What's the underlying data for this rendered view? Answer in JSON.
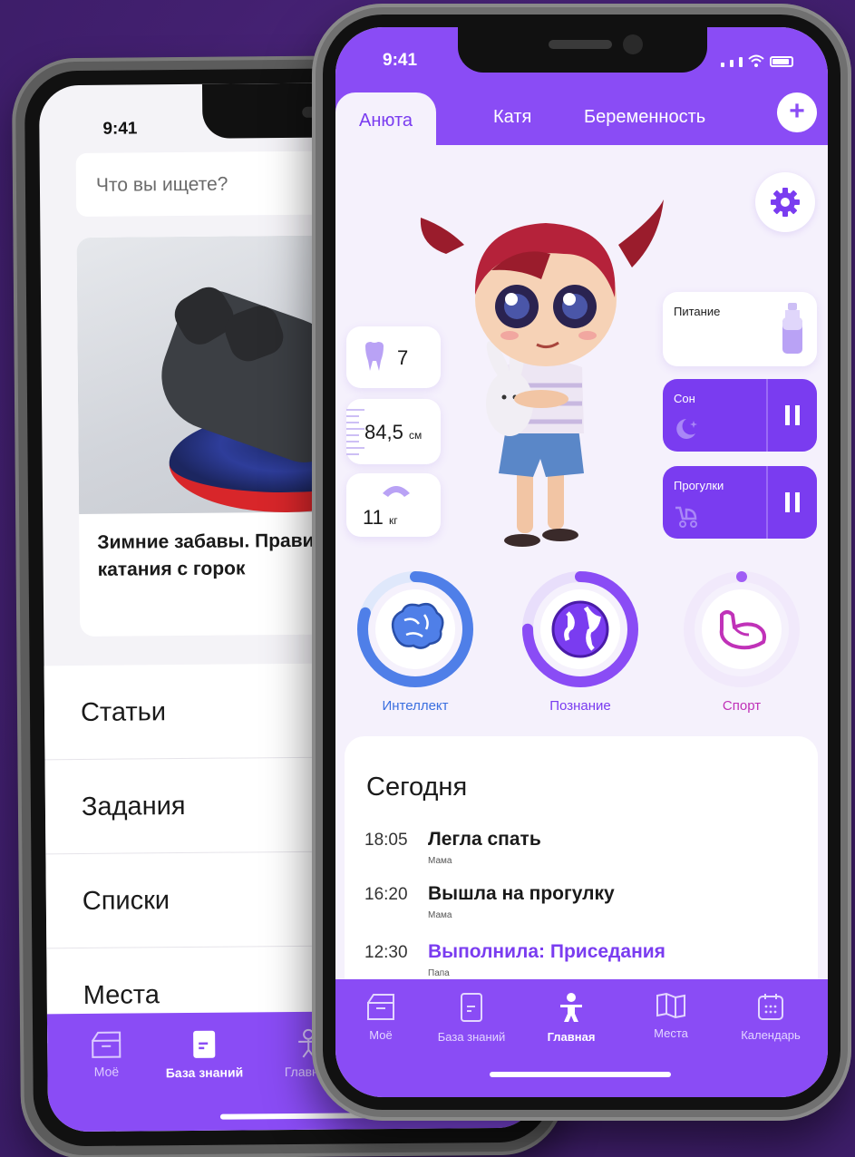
{
  "back_phone": {
    "status_time": "9:41",
    "search": {
      "placeholder": "Что вы ищете?"
    },
    "article_card": {
      "title": "Зимние забавы. Правила безопаснос катания с горок"
    },
    "sections": [
      "Статьи",
      "Задания",
      "Списки",
      "Места"
    ],
    "tabbar": [
      {
        "label": "Моё",
        "icon": "box-icon",
        "active": false
      },
      {
        "label": "База знаний",
        "icon": "book-icon",
        "active": true
      },
      {
        "label": "Главная",
        "icon": "child-icon",
        "active": false
      }
    ]
  },
  "front_phone": {
    "status_time": "9:41",
    "profiles": {
      "tabs": [
        "Анюта",
        "Катя",
        "Беременность"
      ],
      "active": "Анюта",
      "add_label": "+"
    },
    "stats": {
      "teeth": "7",
      "height_value": "84,5",
      "height_unit": "см",
      "weight_value": "11",
      "weight_unit": "кг"
    },
    "trackers": {
      "food": "Питание",
      "sleep": "Сон",
      "walks": "Прогулки"
    },
    "skills": [
      {
        "label": "Интеллект",
        "progress": 0.8,
        "icon": "brain-icon"
      },
      {
        "label": "Познание",
        "progress": 0.75,
        "icon": "globe-icon"
      },
      {
        "label": "Спорт",
        "progress": 0.0,
        "icon": "arm-icon"
      }
    ],
    "today": {
      "title": "Сегодня",
      "events": [
        {
          "time": "18:05",
          "what": "Легла спать",
          "who": "Мама"
        },
        {
          "time": "16:20",
          "what": "Вышла на прогулку",
          "who": "Мама"
        },
        {
          "time": "12:30",
          "what": "Выполнила: Приседания",
          "who": "Папа"
        }
      ]
    },
    "tabbar": [
      {
        "label": "Моё",
        "icon": "box-icon",
        "active": false
      },
      {
        "label": "База знаний",
        "icon": "book-icon",
        "active": false
      },
      {
        "label": "Главная",
        "icon": "child-icon",
        "active": true
      },
      {
        "label": "Места",
        "icon": "map-icon",
        "active": false
      },
      {
        "label": "Календарь",
        "icon": "calendar-icon",
        "active": false
      }
    ]
  },
  "colors": {
    "background": "#4a2a7a",
    "accent": "#8a4cf5",
    "accent_dark": "#7a3cf0",
    "screen_bg": "#f5f1fc"
  }
}
